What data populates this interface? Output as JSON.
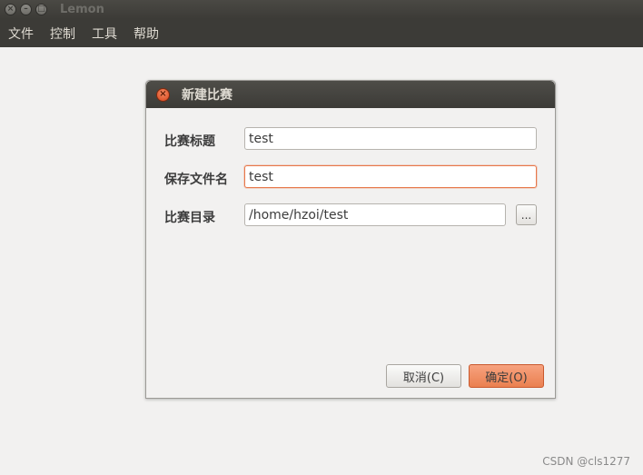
{
  "window": {
    "title": "Lemon",
    "close_glyph": "×",
    "minimize_glyph": "–",
    "maximize_glyph": "□"
  },
  "menubar": {
    "items": [
      {
        "label": "文件"
      },
      {
        "label": "控制"
      },
      {
        "label": "工具"
      },
      {
        "label": "帮助"
      }
    ]
  },
  "dialog": {
    "title": "新建比赛",
    "close_glyph": "×",
    "fields": {
      "contest_title": {
        "label": "比赛标题",
        "value": "test"
      },
      "save_filename": {
        "label": "保存文件名",
        "value": "test"
      },
      "contest_dir": {
        "label": "比赛目录",
        "value": "/home/hzoi/test"
      }
    },
    "browse_label": "...",
    "cancel_label": "取消(C)",
    "ok_label": "确定(O)"
  },
  "watermark": "CSDN @cls1277",
  "colors": {
    "titlebar": "#3c3b37",
    "accent": "#e7784a",
    "background": "#f2f1f0"
  }
}
